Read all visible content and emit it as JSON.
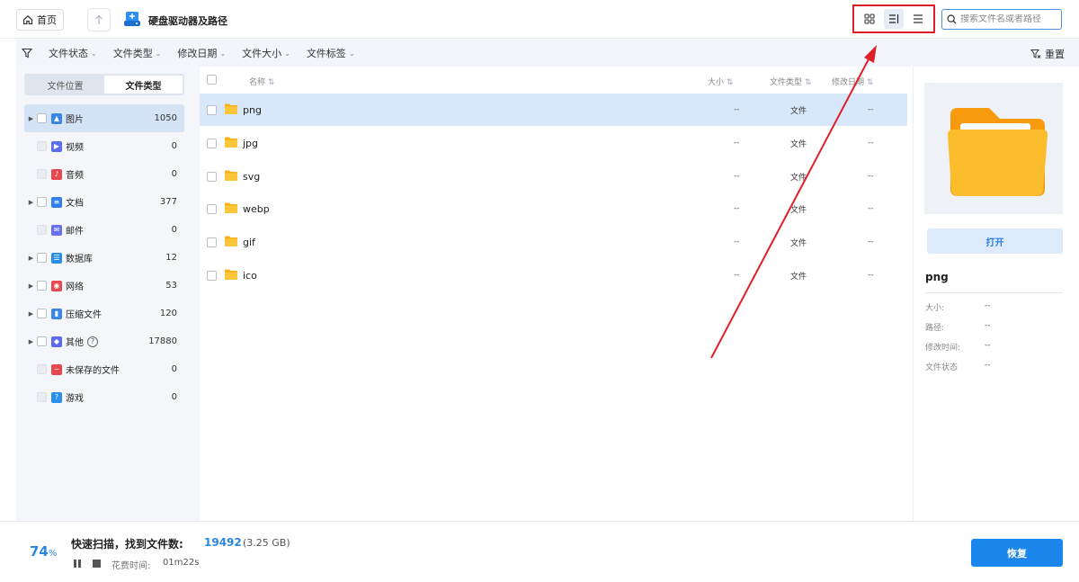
{
  "topbar": {
    "home_label": "首页",
    "title": "硬盘驱动器及路径",
    "search_placeholder": "搜索文件名或者路径"
  },
  "filters": {
    "items": [
      "文件状态",
      "文件类型",
      "修改日期",
      "文件大小",
      "文件标签"
    ],
    "reset_label": "重置"
  },
  "sidebar": {
    "tabs": [
      "文件位置",
      "文件类型"
    ],
    "active_tab": 1,
    "categories": [
      {
        "label": "图片",
        "count": "1050",
        "color": "#3a86e8"
      },
      {
        "label": "视频",
        "count": "0",
        "color": "#5b6cf0"
      },
      {
        "label": "音频",
        "count": "0",
        "color": "#e8484d"
      },
      {
        "label": "文档",
        "count": "377",
        "color": "#2f80ed"
      },
      {
        "label": "邮件",
        "count": "0",
        "color": "#6a6ff0"
      },
      {
        "label": "数据库",
        "count": "12",
        "color": "#2a8de8"
      },
      {
        "label": "网络",
        "count": "53",
        "color": "#e8484d"
      },
      {
        "label": "压缩文件",
        "count": "120",
        "color": "#3a86e8"
      },
      {
        "label": "其他",
        "count": "17880",
        "color": "#5b6cf0"
      },
      {
        "label": "未保存的文件",
        "count": "0",
        "color": "#e8484d"
      },
      {
        "label": "游戏",
        "count": "0",
        "color": "#2a8de8"
      }
    ]
  },
  "table": {
    "headers": {
      "name": "名称",
      "size": "大小",
      "type": "文件类型",
      "date": "修改日期"
    },
    "rows": [
      {
        "name": "png",
        "size": "--",
        "type": "文件",
        "date": "--"
      },
      {
        "name": "jpg",
        "size": "--",
        "type": "文件",
        "date": "--"
      },
      {
        "name": "svg",
        "size": "--",
        "type": "文件",
        "date": "--"
      },
      {
        "name": "webp",
        "size": "--",
        "type": "文件",
        "date": "--"
      },
      {
        "name": "gif",
        "size": "--",
        "type": "文件",
        "date": "--"
      },
      {
        "name": "ico",
        "size": "--",
        "type": "文件",
        "date": "--"
      }
    ]
  },
  "details": {
    "open_label": "打开",
    "file_name": "png",
    "fields": [
      {
        "label": "大小:",
        "value": "--"
      },
      {
        "label": "路径:",
        "value": "--"
      },
      {
        "label": "修改时间:",
        "value": "--"
      },
      {
        "label": "文件状态",
        "value": "--"
      }
    ]
  },
  "status": {
    "percent": "74",
    "percent_sign": "%",
    "scan_title": "快速扫描，找到文件数:",
    "file_count": "19492",
    "total_size": "(3.25 GB)",
    "elapsed_label": "花费时间:",
    "elapsed_value": "01m22s",
    "recover_label": "恢复"
  },
  "colors": {
    "accent": "#1b86ec",
    "highlight_box": "#e01e2a",
    "folder": "#f8b114"
  }
}
